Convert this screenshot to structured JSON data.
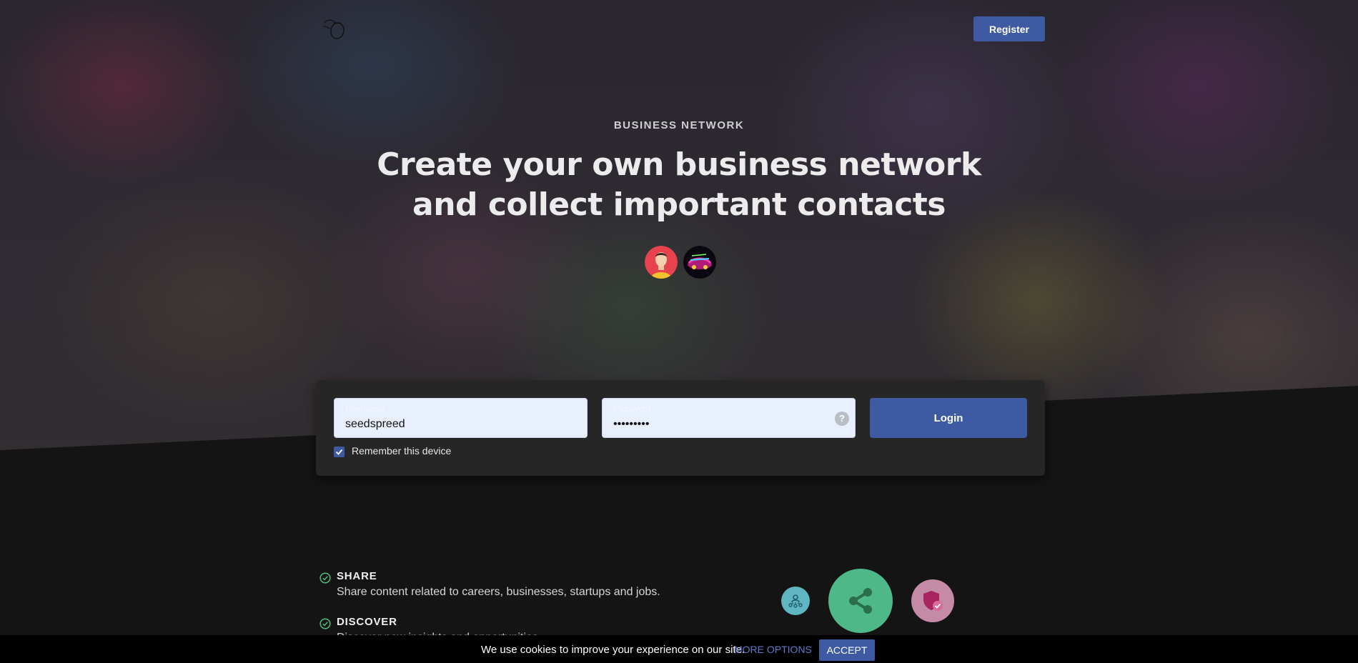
{
  "header": {
    "logo_icon": "hand-drawn-apple-logo-icon",
    "register_label": "Register"
  },
  "hero": {
    "eyebrow": "BUSINESS NETWORK",
    "headline_line1": "Create your own business network",
    "headline_line2": "and collect important contacts",
    "avatars": [
      "avatar-person-icon",
      "avatar-neon-car-icon"
    ]
  },
  "login": {
    "username_label": "Username",
    "username_value": "seedspreed",
    "password_label": "Password",
    "password_value": "•••••••••",
    "help_icon": "question-icon",
    "login_label": "Login",
    "remember_label": "Remember this device",
    "remember_checked": true
  },
  "features": [
    {
      "title": "SHARE",
      "description": "Share content related to careers, businesses, startups and jobs."
    },
    {
      "title": "DISCOVER",
      "description": "Discover new insights and opportunities."
    }
  ],
  "feature_icons": [
    "network-people-icon",
    "share-icon",
    "shield-check-icon"
  ],
  "cookie_bar": {
    "text": "We use cookies to improve your experience on our site.",
    "more_options": "MORE OPTIONS",
    "accept": "ACCEPT"
  },
  "colors": {
    "accent": "#3e5aa3",
    "background": "#141414",
    "card": "#262626",
    "check_green": "#4cbb7a"
  }
}
